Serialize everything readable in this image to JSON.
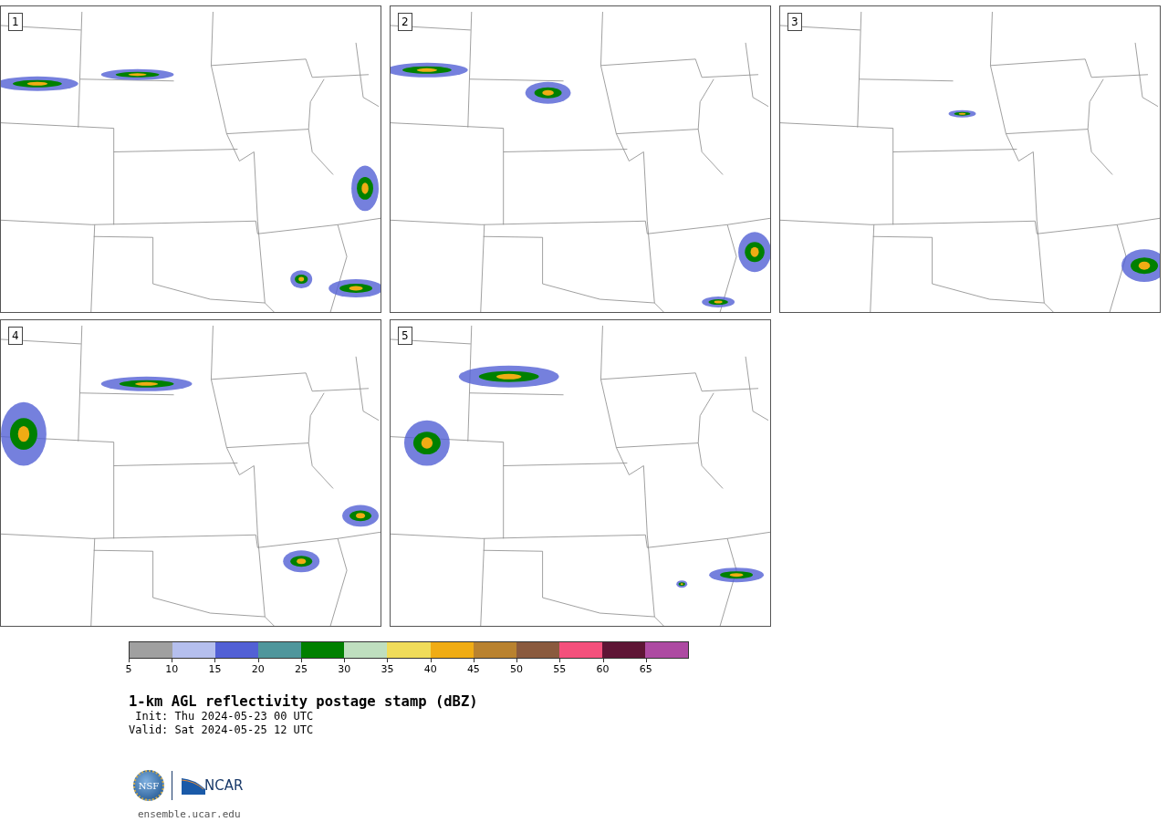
{
  "panels": [
    {
      "label": "1"
    },
    {
      "label": "2"
    },
    {
      "label": "3"
    },
    {
      "label": "4"
    },
    {
      "label": "5"
    }
  ],
  "colorbar": {
    "segments": [
      {
        "color": "#a0a0a0"
      },
      {
        "color": "#b5bfee"
      },
      {
        "color": "#5260d5"
      },
      {
        "color": "#4f969c"
      },
      {
        "color": "#008000"
      },
      {
        "color": "#bfdfbf"
      },
      {
        "color": "#f0dc5a"
      },
      {
        "color": "#f0ac14"
      },
      {
        "color": "#b9822f"
      },
      {
        "color": "#8a5a3e"
      },
      {
        "color": "#f4507c"
      },
      {
        "color": "#5e1535"
      },
      {
        "color": "#ad4aa2"
      }
    ],
    "ticks": [
      "5",
      "10",
      "15",
      "20",
      "25",
      "30",
      "35",
      "40",
      "45",
      "50",
      "55",
      "60",
      "65"
    ]
  },
  "title": "1-km AGL reflectivity postage stamp (dBZ)",
  "init": "Init: Thu 2024-05-23 00 UTC",
  "valid": "Valid: Sat 2024-05-25 12 UTC",
  "logo": {
    "nsf": "NSF",
    "ncar": "NCAR"
  },
  "url": "ensemble.ucar.edu"
}
